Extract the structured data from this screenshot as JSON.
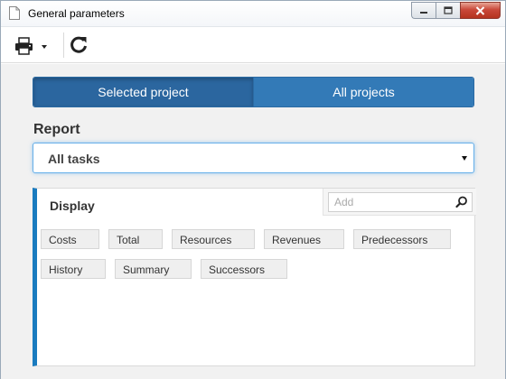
{
  "window": {
    "title": "General parameters"
  },
  "toolbar": {
    "print_icon": "printer-icon",
    "refresh_icon": "refresh-icon"
  },
  "scope": {
    "options": [
      "Selected project",
      "All projects"
    ],
    "selected": "Selected project"
  },
  "report": {
    "label": "Report",
    "selected_value": "All tasks"
  },
  "display": {
    "title": "Display",
    "search_placeholder": "Add",
    "tags": [
      "Costs",
      "Total",
      "Resources",
      "Revenues",
      "Predecessors",
      "History",
      "Summary",
      "Successors"
    ]
  },
  "colors": {
    "accent_blue": "#337ab7",
    "active_blue": "#2b669f",
    "panel_bar": "#1a7bbf"
  }
}
